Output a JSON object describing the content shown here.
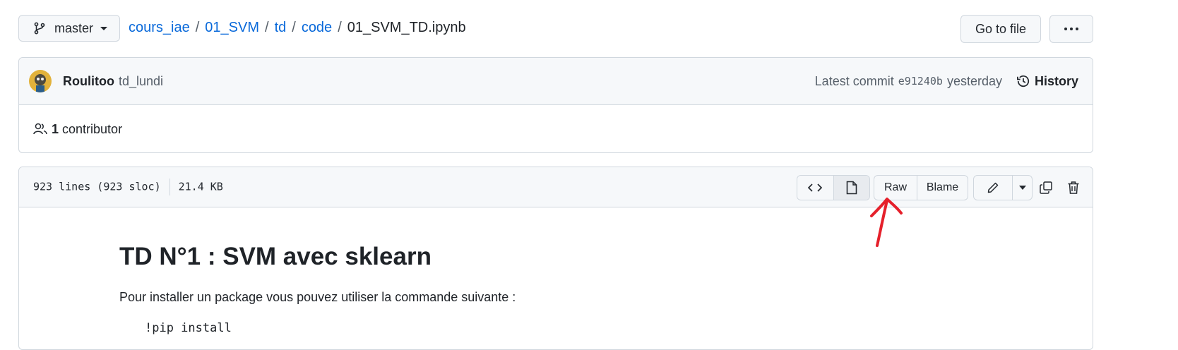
{
  "branch": {
    "name": "master"
  },
  "breadcrumb": {
    "items": [
      "cours_iae",
      "01_SVM",
      "td",
      "code"
    ],
    "separator": "/",
    "current": "01_SVM_TD.ipynb"
  },
  "header_actions": {
    "goto_label": "Go to file",
    "more_icon": "kebab-horizontal-icon"
  },
  "commit": {
    "author": "Roulitoo",
    "message": "td_lundi",
    "latest_label": "Latest commit",
    "sha": "e91240b",
    "time": "yesterday",
    "history_label": "History"
  },
  "contributors": {
    "count": "1",
    "label": "contributor"
  },
  "file": {
    "lines_info": "923 lines (923 sloc)",
    "size": "21.4 KB",
    "raw_label": "Raw",
    "blame_label": "Blame"
  },
  "notebook": {
    "title": "TD N°1 : SVM avec sklearn",
    "text": "Pour installer un package vous pouvez utiliser la commande suivante :",
    "code": "!pip install"
  },
  "colors": {
    "link": "#0969da",
    "annotation": "#e5202b",
    "border": "#d0d7de"
  }
}
